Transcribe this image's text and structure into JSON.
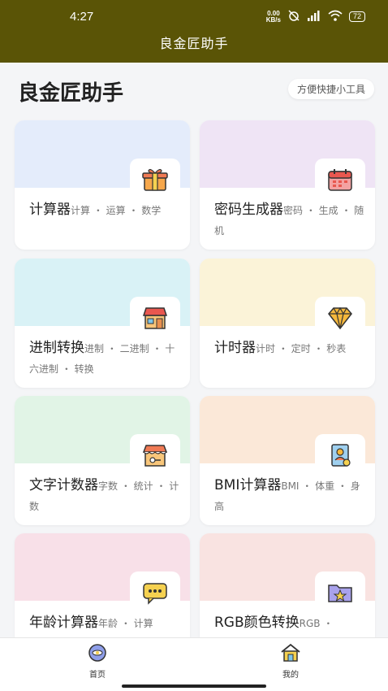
{
  "status": {
    "time": "4:27",
    "net_speed_top": "0.00",
    "net_speed_bottom": "KB/s",
    "battery": "72"
  },
  "app_title": "良金匠助手",
  "page_heading": "良金匠助手",
  "chip_label": "方便快捷小工具",
  "cards": [
    {
      "title": "计算器",
      "tags": "计算 ・ 运算 ・ 数学",
      "bg": "#e4ecfb",
      "icon": "gift-box-icon"
    },
    {
      "title": "密码生成器",
      "tags": "密码 ・ 生成 ・ 随机",
      "bg": "#efe4f5",
      "icon": "calendar-icon"
    },
    {
      "title": "进制转换",
      "tags": "进制 ・ 二进制 ・ 十六进制 ・ 转换",
      "bg": "#d9f2f6",
      "icon": "shop-icon"
    },
    {
      "title": "计时器",
      "tags": "计时 ・ 定时 ・ 秒表",
      "bg": "#fbf3d8",
      "icon": "diamond-icon"
    },
    {
      "title": "文字计数器",
      "tags": "字数 ・ 统计 ・ 计数",
      "bg": "#e1f4e6",
      "icon": "store-icon"
    },
    {
      "title": "BMI计算器",
      "tags": "BMI ・ 体重 ・ 身高",
      "bg": "#fbe8d8",
      "icon": "id-card-icon"
    },
    {
      "title": "年龄计算器",
      "tags": "年龄 ・ 计算",
      "bg": "#f8e0e8",
      "icon": "chat-bubble-icon"
    },
    {
      "title": "RGB颜色转换",
      "tags": "RGB ・",
      "bg": "#f9e3e1",
      "icon": "star-folder-icon"
    }
  ],
  "nav": [
    {
      "label": "首页",
      "icon": "home-orb-icon",
      "active": true
    },
    {
      "label": "我的",
      "icon": "house-icon",
      "active": false
    }
  ]
}
